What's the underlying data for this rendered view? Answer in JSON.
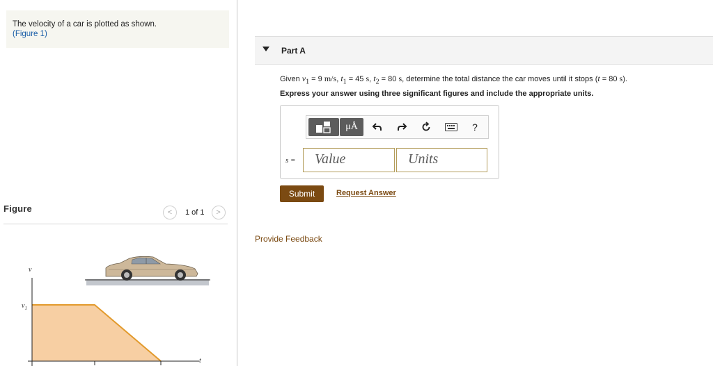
{
  "problem": {
    "statement": "The velocity of a car is plotted as shown.",
    "figure_link": "(Figure 1)"
  },
  "figure_panel": {
    "header": "Figure",
    "pager_text": "1 of 1",
    "prev_glyph": "<",
    "next_glyph": ">",
    "axis_y_label": "v",
    "axis_v1_label": "v",
    "axis_v1_sub": "1",
    "axis_x_label": "t",
    "colors": {
      "area_fill": "#f7cfa3",
      "area_line": "#e29a2c",
      "car_body": "#c9b596",
      "road": "#bcc0c6"
    }
  },
  "part": {
    "caret_icon": "caret-down-icon",
    "title": "Part A",
    "given": {
      "lead": "Given ",
      "v1_var": "v",
      "v1_sub": "1",
      "v1_rest": " = 9 ",
      "v1_unit": "m/s",
      "t1_var": "t",
      "t1_sub": "1",
      "t1_rest": " = 45 ",
      "t1_unit": "s",
      "t2_var": "t",
      "t2_sub": "2",
      "t2_rest": " = 80 ",
      "t2_unit": "s",
      "tail": ", determine the total distance the car moves until it stops (",
      "t_var": "t",
      "t_rest": " = 80 ",
      "t_unit": "s",
      "close": ")."
    },
    "instruction": "Express your answer using three significant figures and include the appropriate units.",
    "toolbar": {
      "templates_icon": "templates-icon",
      "units_label": "μÅ",
      "undo_icon": "undo-icon",
      "redo_icon": "redo-icon",
      "reset_icon": "reset-icon",
      "keyboard_icon": "keyboard-icon",
      "help_label": "?"
    },
    "answer": {
      "variable_label": "s =",
      "value_placeholder": "Value",
      "units_placeholder": "Units"
    },
    "submit_label": "Submit",
    "request_label": "Request Answer"
  },
  "feedback_label": "Provide Feedback"
}
